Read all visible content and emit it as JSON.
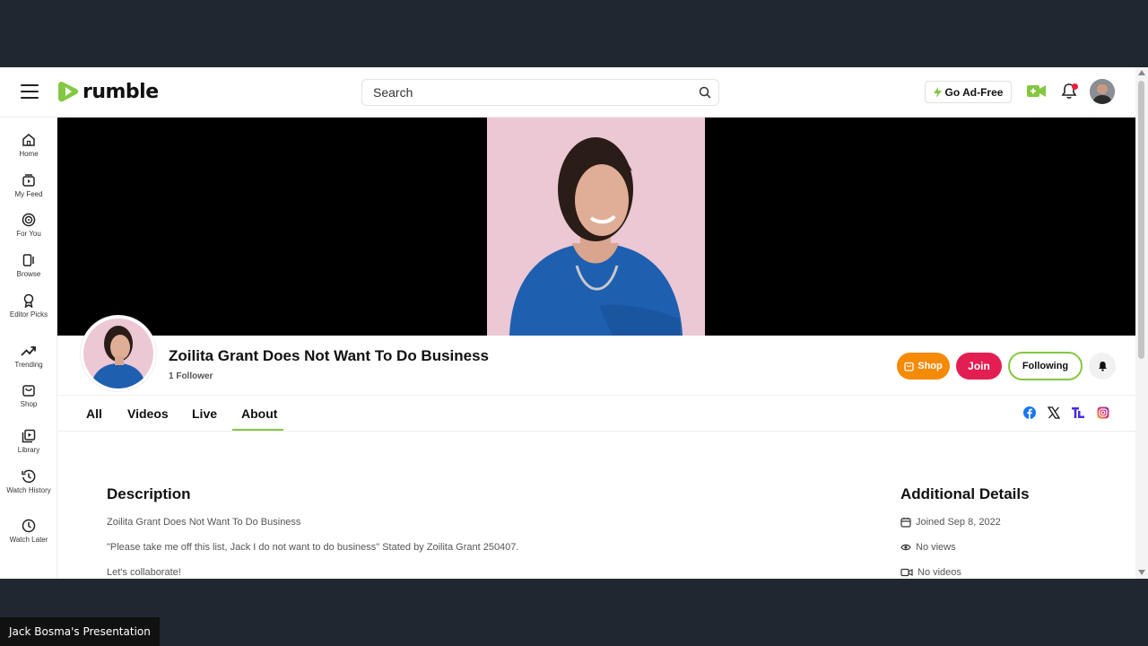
{
  "header": {
    "logo_text": "rumble",
    "search_placeholder": "Search",
    "go_ad_free_label": "Go Ad-Free"
  },
  "sidebar": {
    "items": [
      {
        "label": "Home"
      },
      {
        "label": "My Feed"
      },
      {
        "label": "For You"
      },
      {
        "label": "Browse"
      },
      {
        "label": "Editor Picks"
      },
      {
        "label": "Trending"
      },
      {
        "label": "Shop"
      },
      {
        "label": "Library"
      },
      {
        "label": "Watch History"
      },
      {
        "label": "Watch Later"
      }
    ]
  },
  "channel": {
    "name": "Zoilita Grant Does Not Want To Do Business",
    "followers": "1 Follower",
    "shop_label": "Shop",
    "join_label": "Join",
    "following_label": "Following"
  },
  "tabs": [
    {
      "label": "All"
    },
    {
      "label": "Videos"
    },
    {
      "label": "Live"
    },
    {
      "label": "About",
      "active": true
    }
  ],
  "about": {
    "description_title": "Description",
    "description_lines": [
      "Zoilita Grant Does Not Want To Do Business",
      "\"Please take me off this list, Jack I do not want to do business\" Stated by Zoilita Grant 250407.",
      "Let's collaborate!"
    ],
    "details_title": "Additional Details",
    "joined": "Joined Sep 8, 2022",
    "views": "No views",
    "videos": "No videos"
  },
  "presenter_label": "Jack Bosma's Presentation",
  "colors": {
    "brand_green": "#85c742",
    "shop_orange": "#f58a07",
    "join_red": "#e21e52"
  }
}
